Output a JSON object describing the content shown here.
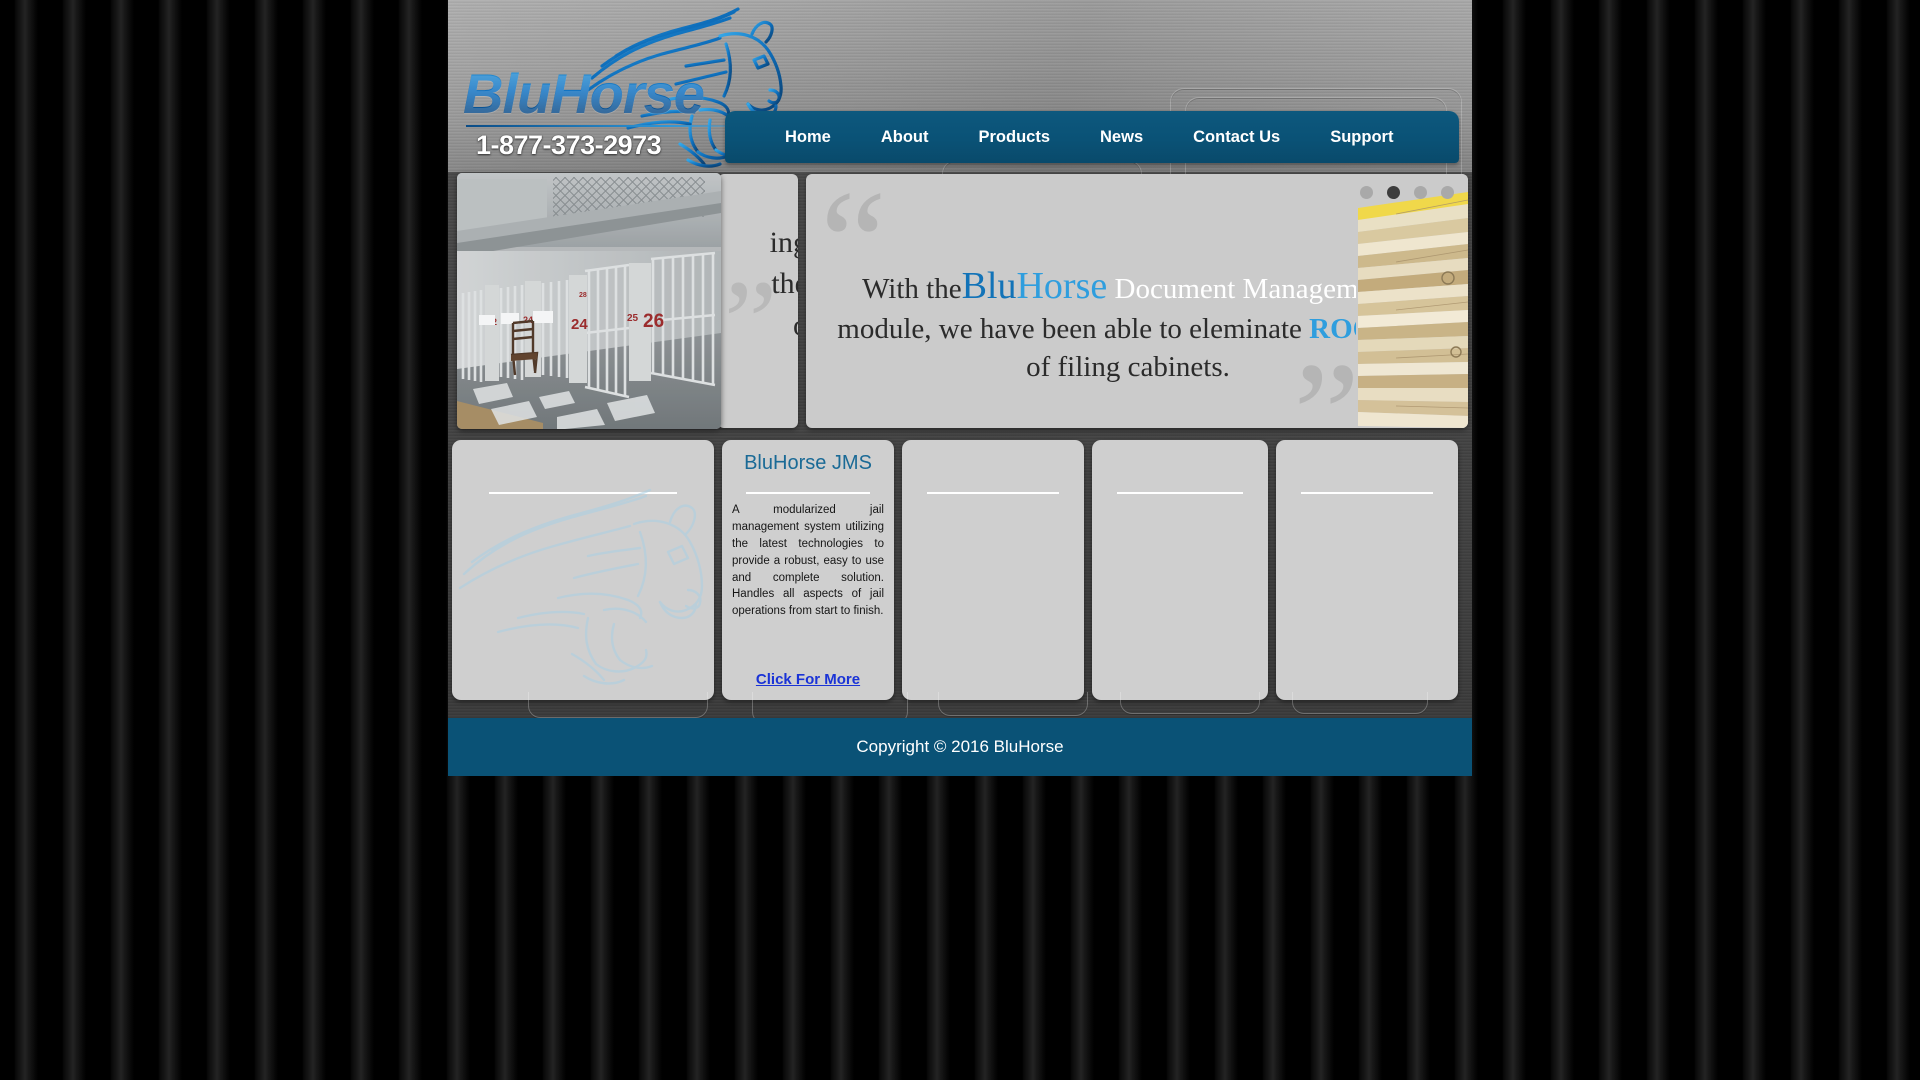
{
  "site": {
    "brand_name": "BluHorse",
    "phone": "1-877-373-2973",
    "accent_blue": "#0a5276",
    "link_blue": "#1a33d6",
    "brand_light_blue": "#2f9ede"
  },
  "nav": {
    "items": [
      {
        "label": "Home"
      },
      {
        "label": "About"
      },
      {
        "label": "Products"
      },
      {
        "label": "News"
      },
      {
        "label": "Contact Us"
      },
      {
        "label": "Support"
      }
    ]
  },
  "slider": {
    "active_index": 1,
    "dot_count": 4,
    "outgoing_slide": {
      "line1": "ing",
      "line2": "the",
      "line3": "o"
    },
    "current_slide": {
      "quote_open": "“",
      "quote_close": "”",
      "text_before": "With the",
      "brand_part1": "Blu",
      "brand_part2": "Horse",
      "text_white": "Document Management",
      "text_middle": "module, we have been able to eleminate",
      "emphasis": "ROOMS",
      "text_after": "of filing cabinets."
    }
  },
  "cards": [
    {
      "title": "",
      "body": "",
      "link": "",
      "watermark": "bluhorse-horse-watermark"
    },
    {
      "title": "BluHorse JMS",
      "body": "A modularized jail management system utilizing the latest technologies to provide a robust, easy to use and complete solution. Handles all aspects of jail operations from start to finish.",
      "link": "Click For More",
      "watermark": ""
    },
    {
      "title": "",
      "body": "",
      "link": "",
      "watermark": ""
    },
    {
      "title": "",
      "body": "",
      "link": "",
      "watermark": ""
    },
    {
      "title": "",
      "body": "",
      "link": "",
      "watermark": ""
    }
  ],
  "footer": {
    "copyright": "Copyright © 2016 BluHorse"
  },
  "banner_image": {
    "alt": "jail-cell-block-photo",
    "cell_numbers": [
      "22",
      "24",
      "25",
      "26"
    ]
  }
}
